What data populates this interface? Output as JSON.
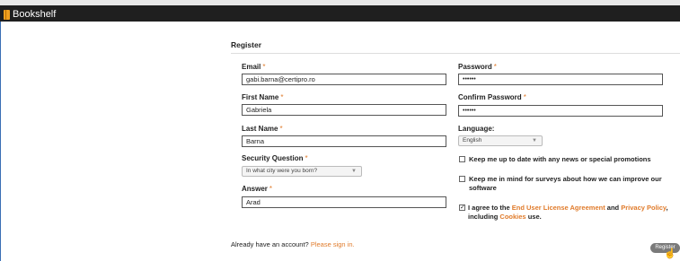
{
  "app": {
    "title": "Bookshelf"
  },
  "form": {
    "title": "Register",
    "email": {
      "label": "Email",
      "value": "gabi.barna@certipro.ro"
    },
    "password": {
      "label": "Password",
      "value": "••••••"
    },
    "first_name": {
      "label": "First Name",
      "value": "Gabriela"
    },
    "confirm_password": {
      "label": "Confirm Password",
      "value": "••••••"
    },
    "last_name": {
      "label": "Last Name",
      "value": "Barna"
    },
    "language": {
      "label": "Language:",
      "value": "English"
    },
    "security_question": {
      "label": "Security Question",
      "value": "In what city were you born?"
    },
    "answer": {
      "label": "Answer",
      "value": "Arad"
    },
    "required_mark": "*",
    "checkbox_news": {
      "label": "Keep me up to date with any news or special promotions",
      "checked": false
    },
    "checkbox_surveys": {
      "label_line1": "Keep me in mind for surveys about how we can improve our",
      "label_line2": "software",
      "checked": false
    },
    "checkbox_agree": {
      "checked": true,
      "mark": "✓",
      "prefix": "I agree to the ",
      "eula_link": "End User License Agreement",
      "and": " and ",
      "privacy_link": "Privacy Policy",
      "comma": ",",
      "including": "including ",
      "cookies_link": "Cookies",
      "suffix": " use."
    }
  },
  "footer": {
    "prompt": "Already have an account? ",
    "signin_link": "Please sign in."
  },
  "register_button": "Register",
  "colors": {
    "accent": "#e07b2b",
    "topbar": "#1f1f1f",
    "frame": "#3a6fb5"
  }
}
